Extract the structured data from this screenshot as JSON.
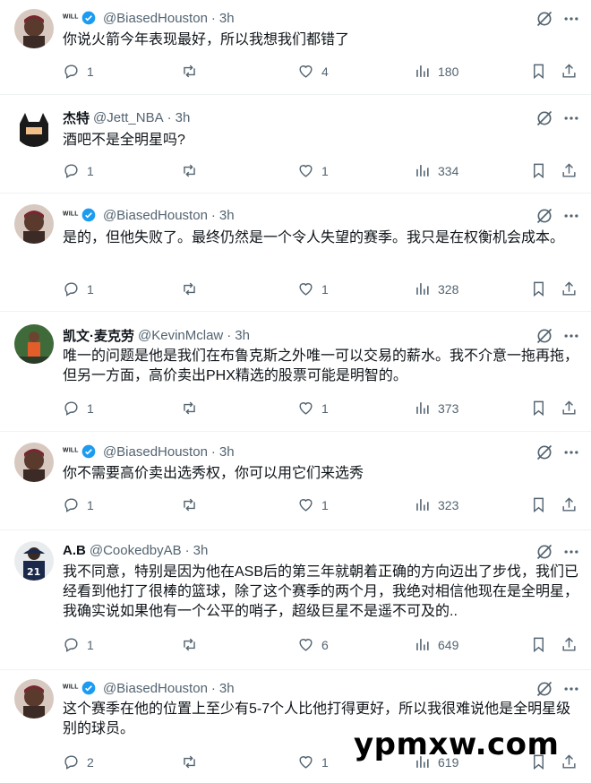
{
  "tweets": [
    {
      "name": "ᵂᴵᴸᴸ",
      "handle": "@BiasedHouston",
      "dot": "·",
      "time": "3h",
      "verified": true,
      "text": "你说火箭今年表现最好，所以我想我们都错了",
      "replies": "1",
      "reposts": "",
      "likes": "4",
      "views": "180"
    },
    {
      "name": "杰特",
      "handle": "@Jett_NBA",
      "dot": "·",
      "time": "3h",
      "verified": false,
      "text": "酒吧不是全明星吗?",
      "replies": "1",
      "reposts": "",
      "likes": "1",
      "views": "334"
    },
    {
      "name": "ᵂᴵᴸᴸ",
      "handle": "@BiasedHouston",
      "dot": "·",
      "time": "3h",
      "verified": true,
      "text": "是的，但他失败了。最终仍然是一个令人失望的赛季。我只是在权衡机会成本。",
      "replies": "1",
      "reposts": "",
      "likes": "1",
      "views": "328"
    },
    {
      "name": "凯文·麦克劳",
      "handle": "@KevinMclaw",
      "dot": "·",
      "time": "3h",
      "verified": false,
      "text": "唯一的问题是他是我们在布鲁克斯之外唯一可以交易的薪水。我不介意一拖再拖，但另一方面，高价卖出PHX精选的股票可能是明智的。",
      "replies": "1",
      "reposts": "",
      "likes": "1",
      "views": "373"
    },
    {
      "name": "ᵂᴵᴸᴸ",
      "handle": "@BiasedHouston",
      "dot": "·",
      "time": "3h",
      "verified": true,
      "text": "你不需要高价卖出选秀权，你可以用它们来选秀",
      "replies": "1",
      "reposts": "",
      "likes": "1",
      "views": "323"
    },
    {
      "name": "A.B",
      "handle": "@CookedbyAB",
      "dot": "·",
      "time": "3h",
      "verified": false,
      "text": "我不同意，特别是因为他在ASB后的第三年就朝着正确的方向迈出了步伐，我们已经看到他打了很棒的篮球，除了这个赛季的两个月，我绝对相信他现在是全明星，我确实说如果他有一个公平的哨子，超级巨星不是遥不可及的..",
      "replies": "1",
      "reposts": "",
      "likes": "6",
      "views": "649"
    },
    {
      "name": "ᵂᴵᴸᴸ",
      "handle": "@BiasedHouston",
      "dot": "·",
      "time": "3h",
      "verified": true,
      "text": "这个赛季在他的位置上至少有5-7个人比他打得更好，所以我很难说他是全明星级别的球员。",
      "replies": "2",
      "reposts": "",
      "likes": "1",
      "views": "619"
    }
  ],
  "watermark": "ypmxw.com",
  "colors": {
    "verified": "#1d9bf0",
    "muted": "#536471",
    "text": "#0f1419",
    "divider": "#eff3f4"
  }
}
